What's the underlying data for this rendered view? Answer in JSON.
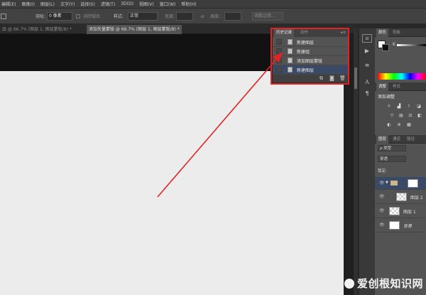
{
  "menu": [
    "编辑(E)",
    "图像(I)",
    "图层(L)",
    "文字(Y)",
    "选择(S)",
    "滤镜(T)",
    "3D(D)",
    "视图(V)",
    "窗口(W)",
    "帮助(H)"
  ],
  "options": {
    "feather_label": "羽化:",
    "feather_value": "0 像素",
    "antialias_label": "消除锯齿",
    "style_label": "样式:",
    "style_value": "正常",
    "width_label": "宽度:",
    "height_label": "高度:",
    "refine_edge_label": "调整边缘..."
  },
  "doc_tabs": [
    {
      "label": "品 @ 66.7% (图层 1, 图层蒙版/8) *",
      "active": false
    },
    {
      "label": "添加矢量蒙版 @ 66.7% (图层 1, 图层蒙版/8) *",
      "active": true
    }
  ],
  "history_panel": {
    "tabs": [
      "历史记录",
      "动作"
    ],
    "items": [
      {
        "label": "新建图层",
        "selected": false
      },
      {
        "label": "新建组",
        "selected": false
      },
      {
        "label": "添加图层蒙版",
        "selected": false
      },
      {
        "label": "新建图层",
        "selected": true
      }
    ]
  },
  "color_panel": {
    "tabs": [
      "颜色",
      "色板"
    ],
    "channel": "K"
  },
  "adjustments_panel": {
    "tabs": [
      "调整",
      "样式"
    ],
    "title": "添加调整"
  },
  "layers_panel": {
    "tabs": [
      "图层",
      "通道",
      "路径"
    ],
    "kind_label": "ρ 类型",
    "blend_mode": "穿透",
    "lock_label": "锁定:",
    "layers": [
      {
        "name": "",
        "type": "group",
        "selected": true
      },
      {
        "name": "图层 2",
        "type": "transparent"
      },
      {
        "name": "图层 1",
        "type": "transparent"
      },
      {
        "name": "背景",
        "type": "white"
      }
    ]
  },
  "watermark": "爱创根知识网",
  "accent_red": "#e02424"
}
